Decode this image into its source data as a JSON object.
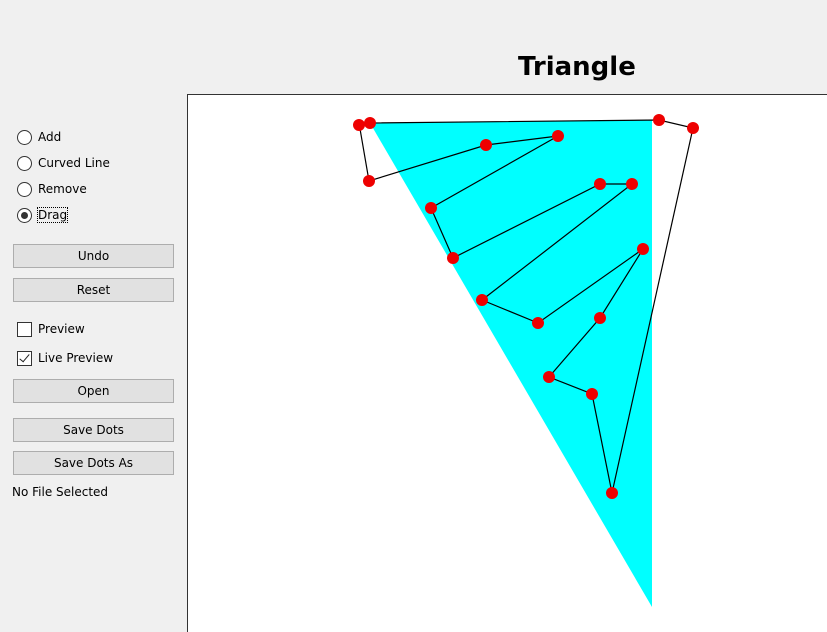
{
  "title": "Triangle",
  "modes": [
    {
      "label": "Add",
      "selected": false
    },
    {
      "label": "Curved Line",
      "selected": false
    },
    {
      "label": "Remove",
      "selected": false
    },
    {
      "label": "Drag",
      "selected": true
    }
  ],
  "buttons": {
    "undo": "Undo",
    "reset": "Reset",
    "open": "Open",
    "save_dots": "Save Dots",
    "save_dots_as": "Save Dots As"
  },
  "options": {
    "preview": {
      "label": "Preview",
      "checked": false
    },
    "live_preview": {
      "label": "Live Preview",
      "checked": true
    }
  },
  "status": "No File Selected",
  "colors": {
    "fill": "#00ffff",
    "dot": "#ee0000",
    "line": "#000000"
  }
}
